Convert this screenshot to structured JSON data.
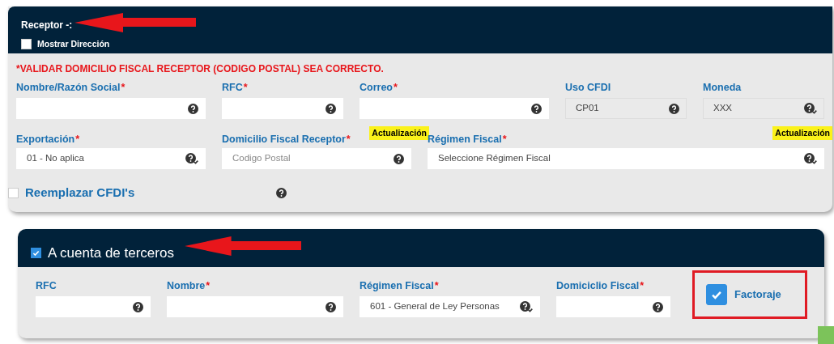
{
  "receptor_panel": {
    "title": "Receptor -:",
    "show_address": {
      "label": "Mostrar Dirección",
      "checked": false
    },
    "warning": "*VALIDAR DOMICILIO FISCAL RECEPTOR (CODIGO POSTAL) SEA CORRECTO.",
    "field_rows": [
      [
        {
          "label": "Nombre/Razón Social",
          "required_mark": "*",
          "kind": "help",
          "disabled": false
        },
        {
          "label": "RFC",
          "required_mark": "*",
          "kind": "help",
          "disabled": false
        },
        {
          "label": "Correo",
          "required_mark": "*",
          "kind": "help",
          "disabled": false
        },
        {
          "label": "Uso CFDI",
          "value": "CP01",
          "kind": "help",
          "disabled": true
        },
        {
          "label": "Moneda",
          "value": "XXX",
          "kind": "select",
          "disabled": true
        }
      ],
      [
        {
          "label": "Exportación",
          "required_mark": "*",
          "value": "01 - No aplica",
          "kind": "select",
          "disabled": false
        },
        {
          "label": "Domicilio Fiscal Receptor",
          "required_mark": "*",
          "placeholder": "Codigo Postal",
          "kind": "help",
          "disabled": false,
          "badge": "Actualización"
        },
        {
          "label": "Régimen Fiscal",
          "required_mark": "*",
          "value": "Seleccione Régimen Fiscal",
          "kind": "select",
          "disabled": false,
          "badge": "Actualización"
        }
      ]
    ],
    "replace_cfdi": {
      "label": "Reemplazar CFDI's",
      "checked": false
    }
  },
  "third_party_panel": {
    "title": "A cuenta de terceros",
    "checked": true,
    "fields": [
      {
        "label": "RFC",
        "kind": "help",
        "disabled": false
      },
      {
        "label": "Nombre",
        "required_mark": "*",
        "kind": "help",
        "disabled": false
      },
      {
        "label": "Régimen Fiscal",
        "required_mark": "*",
        "value": "601 - General de Ley Personas",
        "kind": "select",
        "disabled": false
      },
      {
        "label": "Domiciclio Fiscal",
        "required_mark": "*",
        "kind": "help",
        "disabled": false
      }
    ],
    "factoring": {
      "label": "Factoraje",
      "checked": true
    }
  }
}
